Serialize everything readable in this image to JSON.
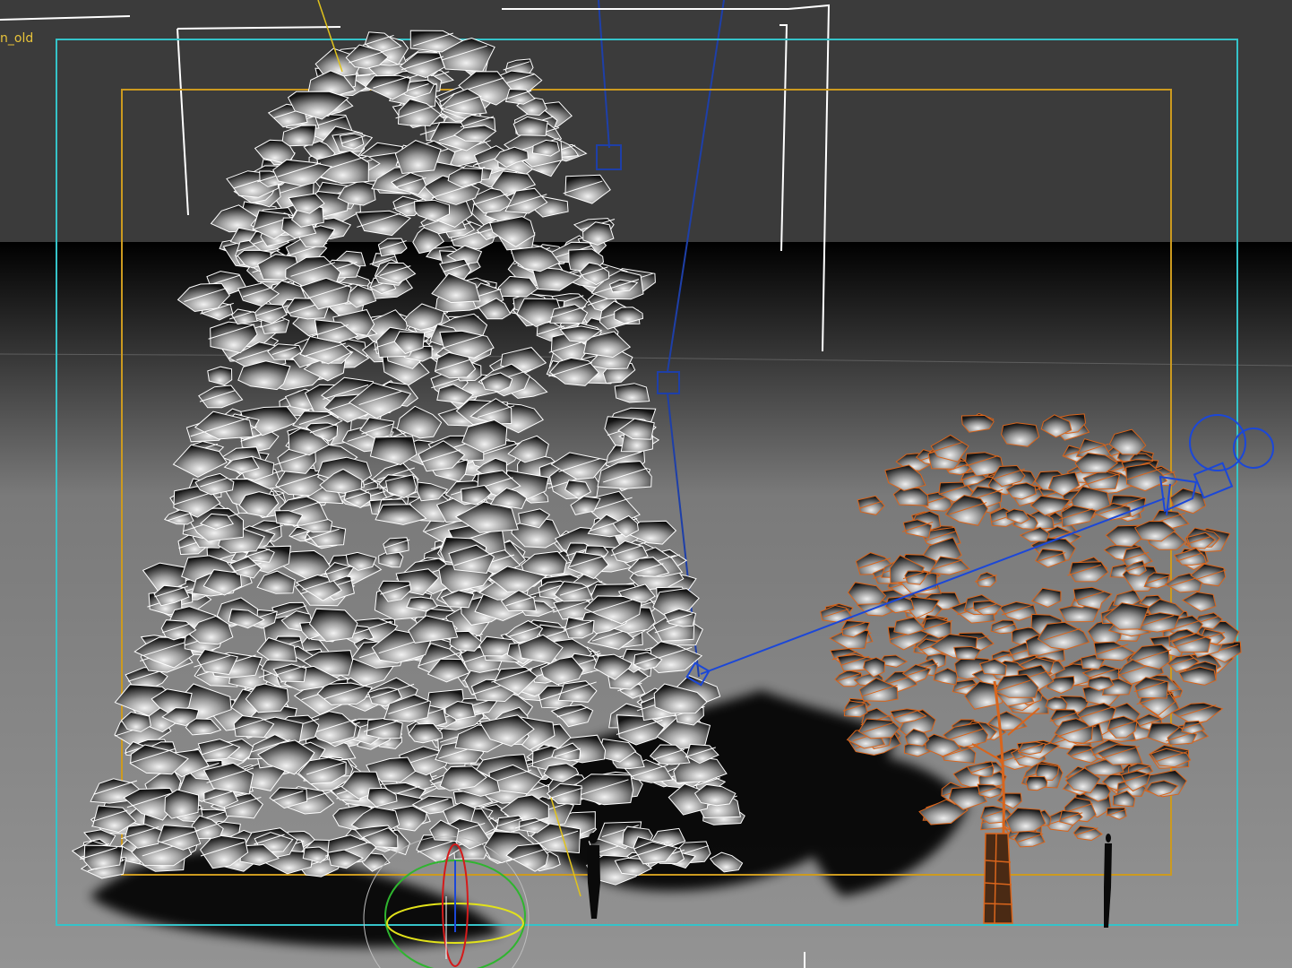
{
  "viewport": {
    "label": "n_old"
  },
  "colors": {
    "background": "#3b3b3b",
    "floor": "#8e8e8e",
    "wire_unselected": "#ffffff",
    "wire_selected": "#d9651c",
    "safe_frame_outer": "#35c3c9",
    "safe_frame_inner": "#cc9a1f",
    "light_helper": "#1e3fa8",
    "camera_helper": "#1b47d8",
    "label": "#e8c33a",
    "gizmo_x": "#d41b1b",
    "gizmo_y": "#2fb52f",
    "gizmo_z": "#e2e21a"
  },
  "scene_objects": [
    {
      "name": "large-tree",
      "selected": false,
      "style": "wireframe-over-shaded"
    },
    {
      "name": "small-tree",
      "selected": true,
      "style": "wireframe-over-shaded"
    },
    {
      "name": "human-scale-figure-1"
    },
    {
      "name": "human-scale-figure-2"
    },
    {
      "name": "spot-light"
    },
    {
      "name": "camera"
    }
  ]
}
